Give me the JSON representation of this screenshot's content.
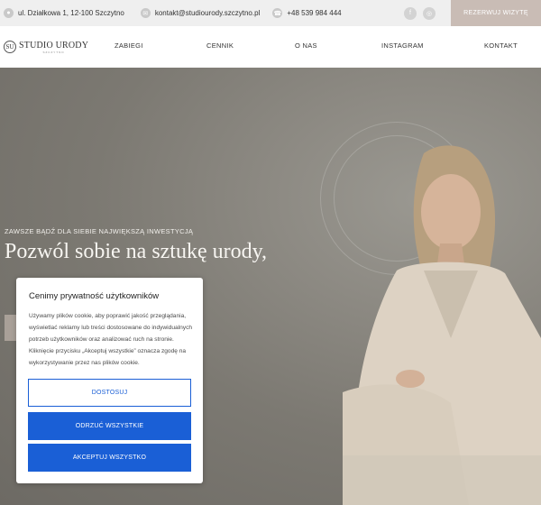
{
  "topbar": {
    "address": "ul. Działkowa 1, 12-100 Szczytno",
    "email": "kontakt@studiourody.szczytno.pl",
    "phone": "+48 539 984 444",
    "reserve_label": "REZERWUJ WIZYTĘ",
    "icons": [
      "location-icon",
      "mail-icon",
      "phone-icon",
      "facebook-icon",
      "instagram-icon"
    ]
  },
  "logo": {
    "mark": "SU",
    "name": "STUDIO URODY",
    "tagline": "SZCZYTNO"
  },
  "nav": {
    "items": [
      "ZABIEGI",
      "CENNIK",
      "O NAS",
      "INSTAGRAM",
      "KONTAKT"
    ]
  },
  "hero": {
    "kicker": "ZAWSZE BĄDŹ DLA SIEBIE NAJWIĘKSZĄ INWESTYCJĄ",
    "headline": "Pozwól sobie na sztukę urody,"
  },
  "cookie": {
    "title": "Cenimy prywatność użytkowników",
    "text": "Używamy plików cookie, aby poprawić jakość przeglądania, wyświetlać reklamy lub treści dostosowane do indywidualnych potrzeb użytkowników oraz analizować ruch na stronie. Kliknięcie przycisku „Akceptuj wszystkie” oznacza zgodę na wykorzystywanie przez nas plików cookie.",
    "customize_label": "DOSTOSUJ",
    "reject_label": "ODRZUĆ WSZYSTKIE",
    "accept_label": "AKCEPTUJ WSZYSTKO"
  },
  "colors": {
    "accent": "#1a5fd6",
    "reserve_bg": "#c9bcb5",
    "hero_bg": "#8d8a83"
  }
}
